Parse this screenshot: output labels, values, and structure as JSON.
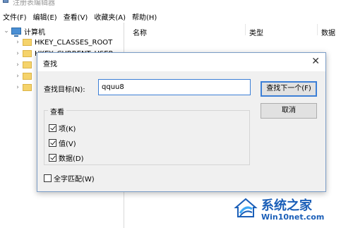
{
  "app": {
    "title": "注册表编辑器"
  },
  "menu": [
    "文件(F)",
    "编辑(E)",
    "查看(V)",
    "收藏夹(A)",
    "帮助(H)"
  ],
  "tree": {
    "root_label": "计算机",
    "items": [
      "HKEY_CLASSES_ROOT",
      "HKEY_CURRENT_USER",
      "",
      "",
      ""
    ]
  },
  "list": {
    "columns": [
      "名称",
      "类型",
      "数据"
    ]
  },
  "find_dialog": {
    "title": "查找",
    "find_label": "查找目标(N):",
    "find_value": "qquu8",
    "find_next_label": "查找下一个(F)",
    "cancel_label": "取消",
    "look_at_group": "查看",
    "options": [
      {
        "label": "项(K)",
        "checked": true
      },
      {
        "label": "值(V)",
        "checked": true
      },
      {
        "label": "数据(D)",
        "checked": true
      }
    ],
    "whole_word": {
      "label": "全字匹配(W)",
      "checked": false
    }
  },
  "watermark": {
    "brand": "系统之家",
    "url": "Win10net.com",
    "colors": {
      "primary": "#1b5fb8",
      "accent": "#3fa9f5"
    }
  },
  "colors": {
    "accent_blue": "#3c7fd6",
    "dialog_bg": "#f0f0f0",
    "folder": "#f5d36b"
  }
}
